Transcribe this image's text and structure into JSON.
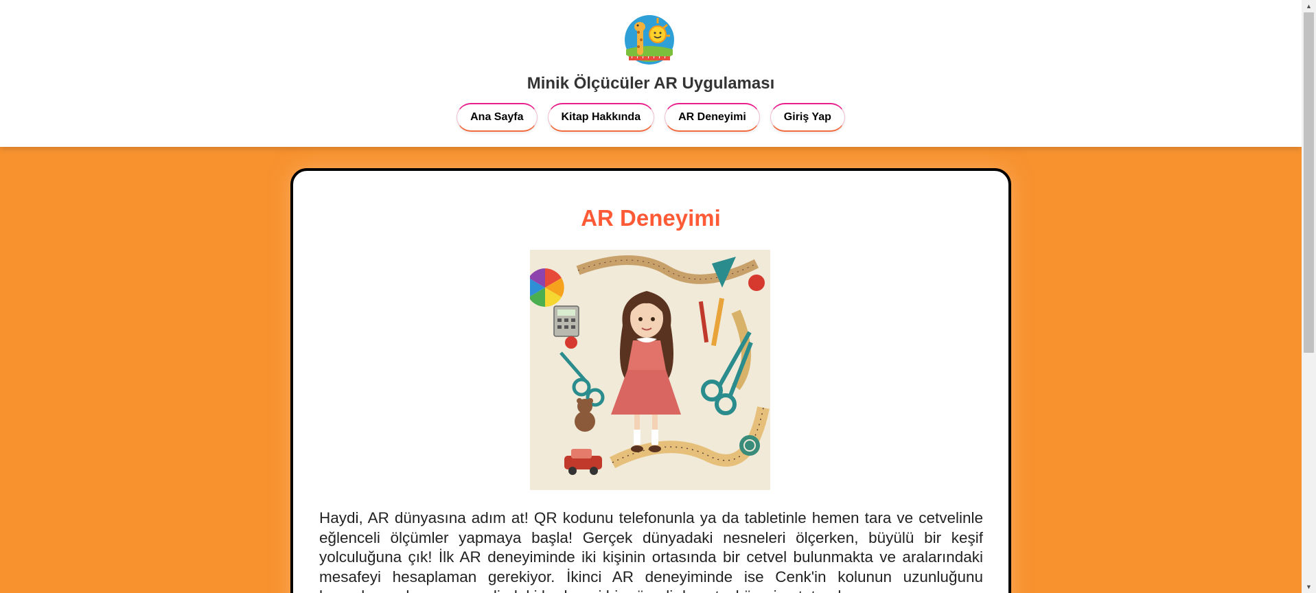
{
  "header": {
    "site_title": "Minik Ölçücüler AR Uygulaması",
    "logo_icon": "giraffe-sun-logo-icon",
    "nav": [
      {
        "label": "Ana Sayfa"
      },
      {
        "label": "Kitap Hakkında"
      },
      {
        "label": "AR Deneyimi"
      },
      {
        "label": "Giriş Yap"
      }
    ]
  },
  "main": {
    "heading": "AR Deneyimi",
    "hero_image": "girl-with-measuring-tools-illustration",
    "description": "Haydi, AR dünyasına adım at! QR kodunu telefonunla ya da tabletinle hemen tara ve cetvelinle eğlenceli ölçümler yapmaya başla! Gerçek dünyadaki nesneleri ölçerken, büyülü bir keşif yolculuğuna çık! İlk AR deneyiminde iki kişinin ortasında bir cetvel bulunmakta ve aralarındaki mesafeyi hesaplaman gerekiyor. İkinci AR deneyiminde ise Cenk'in kolunun uzunluğunu hesaplayacaksın ayrıca elindeki herhangi bir görseli de cetvel üzerine tutarak"
  },
  "colors": {
    "background": "#f7922f",
    "heading": "#ff5a36",
    "nav_border_top": "#e91e8c",
    "nav_border_bottom": "#f26a3e"
  }
}
